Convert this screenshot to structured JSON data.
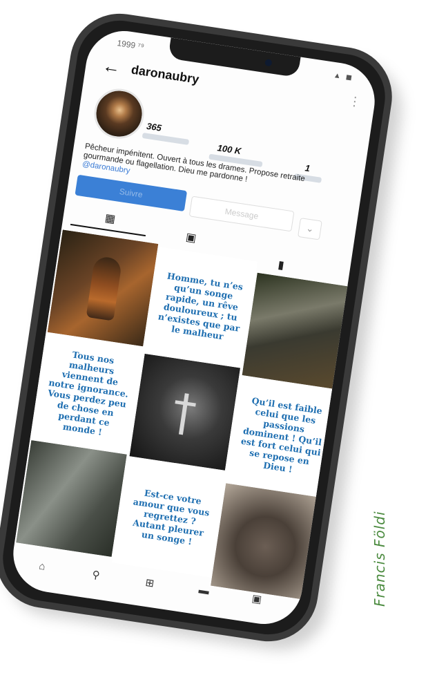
{
  "status_bar": {
    "time": "1999 ⁷⁹",
    "right": "▲ ◼"
  },
  "profile": {
    "username": "daronaubry",
    "back_icon": "back-arrow-icon",
    "posts_count": "365",
    "followers_count": "100 K",
    "following_count": "1",
    "bio_text": "Pêcheur impénitent. Ouvert à tous les drames. Propose retraite gourmande ou flagellation. Dieu me pardonne !",
    "bio_handle": "@daronaubry"
  },
  "actions": {
    "follow_label": "Suivre",
    "message_label": "Message",
    "more_label": "⌄"
  },
  "tabs": [
    "grid-icon",
    "reels-icon",
    "tagged-icon"
  ],
  "grid": [
    {
      "type": "image",
      "icon": "painting-monk"
    },
    {
      "type": "quote",
      "text": "Homme, tu n’es qu’un songe rapide, un rêve douloureux ; tu n’existes que par le malheur"
    },
    {
      "type": "image",
      "icon": "painting-dark"
    },
    {
      "type": "quote",
      "text": "Tous nos malheurs viennent de notre ignorance. Vous perdez peu de chose en perdant ce monde !"
    },
    {
      "type": "image",
      "icon": "painting-cross"
    },
    {
      "type": "quote",
      "text": "Qu’il est faible celui que les passions dominent ! Qu’il est fort celui qui se repose en Dieu !"
    },
    {
      "type": "image",
      "icon": "painting-grey"
    },
    {
      "type": "quote",
      "text": "Est-ce votre amour que vous regrettez ? Autant pleurer un songe !"
    },
    {
      "type": "image",
      "icon": "painting-figures"
    }
  ],
  "bottom_nav": [
    "home-icon",
    "search-icon",
    "add-post-icon",
    "shop-icon",
    "profile-icon"
  ],
  "credit": "Francis Földi",
  "colors": {
    "accent": "#3b80d6",
    "quote": "#1f6fb1",
    "credit": "#4a8a3e"
  }
}
